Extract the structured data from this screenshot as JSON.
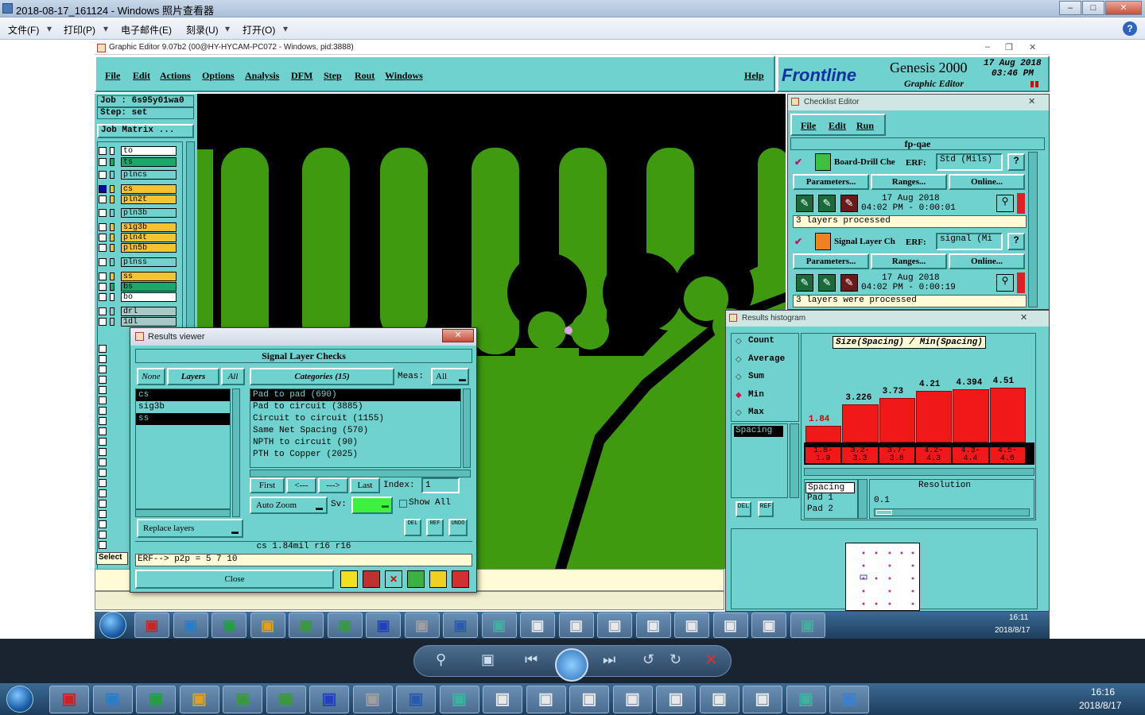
{
  "photo_viewer": {
    "title": "2018-08-17_161124 - Windows 照片查看器",
    "menu": [
      "文件(F)",
      "打印(P)",
      "电子邮件(E)",
      "刻录(U)",
      "打开(O)"
    ],
    "help_glyph": "?"
  },
  "ge": {
    "title": "Graphic Editor 9.07b2 (00@HY-HYCAM-PC072 - Windows, pid:3888)",
    "menu": [
      "File",
      "Edit",
      "Actions",
      "Options",
      "Analysis",
      "DFM",
      "Step",
      "Rout",
      "Windows"
    ],
    "help": "Help",
    "brand": "Frontline",
    "product": "Genesis 2000",
    "subtitle": "Graphic Editor",
    "date": "17 Aug 2018",
    "time": "03:46 PM",
    "job_label": "Job : 6s95y01wa0",
    "step_label": "Step: set",
    "job_matrix": "Job Matrix ...",
    "select_label": "Select"
  },
  "layers": [
    {
      "name": "to",
      "color": "#ffffff",
      "on": false
    },
    {
      "name": "ts",
      "color": "#1aa86a",
      "on": false
    },
    {
      "name": "plncs",
      "color": "#6fd2cf",
      "on": false
    },
    {
      "name": "cs",
      "color": "#f4c430",
      "on": true
    },
    {
      "name": "pln2t",
      "color": "#f4c430",
      "on": false
    },
    {
      "name": "pln3b",
      "color": "#6fd2cf",
      "on": false
    },
    {
      "name": "sig3b",
      "color": "#f4c430",
      "on": false
    },
    {
      "name": "pln4t",
      "color": "#f4c430",
      "on": false
    },
    {
      "name": "pln5b",
      "color": "#f4c430",
      "on": false
    },
    {
      "name": "plnss",
      "color": "#6fd2cf",
      "on": false
    },
    {
      "name": "ss",
      "color": "#f4c430",
      "on": false
    },
    {
      "name": "bs",
      "color": "#1aa86a",
      "on": false
    },
    {
      "name": "bo",
      "color": "#ffffff",
      "on": false
    },
    {
      "name": "drl",
      "color": "#a8c8c8",
      "on": false
    },
    {
      "name": "1dl",
      "color": "#a8c8c8",
      "on": false
    }
  ],
  "checklist": {
    "title": "Checklist Editor",
    "menu": [
      "File",
      "Edit",
      "Run"
    ],
    "name": "fp-qae",
    "items": [
      {
        "name": "Board-Drill Che",
        "erf_label": "ERF:",
        "erf": "Std (Mils)",
        "date": "17 Aug 2018",
        "time": "04:02 PM - 0:00:01",
        "status": "3 layers processed"
      },
      {
        "name": "Signal Layer Ch",
        "erf_label": "ERF:",
        "erf": "signal (Mi",
        "date": "17 Aug 2018",
        "time": "04:02 PM - 0:00:19",
        "status": "3 layers were processed"
      }
    ],
    "buttons": [
      "Parameters...",
      "Ranges...",
      "Online..."
    ]
  },
  "histogram": {
    "title": "Results histogram",
    "options": [
      "Count",
      "Average",
      "Sum",
      "Min",
      "Max"
    ],
    "selected_option": "Min",
    "list_item": "Spacing",
    "chart_title": "Size(Spacing) / Min(Spacing)",
    "bars": [
      {
        "value": "1.84",
        "range": "1.8- 1.9",
        "level": 0.3,
        "label_color": "#d00"
      },
      {
        "value": "3.226",
        "range": "3.2- 3.3",
        "level": 0.68,
        "label_color": "#000"
      },
      {
        "value": "3.73",
        "range": "3.7- 3.8",
        "level": 0.8,
        "label_color": "#000"
      },
      {
        "value": "4.21",
        "range": "4.2- 4.3",
        "level": 0.93,
        "label_color": "#000"
      },
      {
        "value": "4.394",
        "range": "4.3- 4.4",
        "level": 0.96,
        "label_color": "#000"
      },
      {
        "value": "4.51",
        "range": "4.5- 4.6",
        "level": 0.99,
        "label_color": "#000"
      }
    ],
    "detail_rows": [
      "Spacing",
      "Pad 1",
      "Pad 2"
    ],
    "resolution_label": "Resolution",
    "resolution_value": "0.1",
    "del_label": "DEL",
    "ref_label": "REF"
  },
  "results_viewer": {
    "title": "Results viewer",
    "header": "Signal Layer Checks",
    "none": "None",
    "layers": "Layers",
    "all": "All",
    "categories": "Categories (15)",
    "meas_label": "Meas:",
    "meas_value": "All",
    "layer_list": [
      "cs",
      "sig3b",
      "ss"
    ],
    "layer_selected": [
      true,
      false,
      true
    ],
    "category_list": [
      "Pad to pad (690)",
      "Pad to circuit (3885)",
      "Circuit to circuit (1155)",
      "Same Net Spacing (570)",
      "NPTH to circuit (90)",
      "PTH to Copper (2025)"
    ],
    "nav": [
      "First",
      "<---",
      "--->",
      "Last"
    ],
    "index_label": "Index:",
    "index_value": "1",
    "auto_zoom": "Auto Zoom",
    "sv_label": "Sv:",
    "show_all": "Show All",
    "replace_layers": "Replace layers",
    "measure_line": "cs 1.84mil  r16  r16",
    "erf_line": "ERF--> p2p = 5 7 10",
    "close": "Close",
    "small_buttons": [
      "DEL",
      "REF",
      "UNDO"
    ]
  },
  "taskbar1": {
    "time": "16:11",
    "date": "2018/8/17"
  },
  "taskbar2": {
    "time": "16:16",
    "date": "2018/8/17"
  }
}
